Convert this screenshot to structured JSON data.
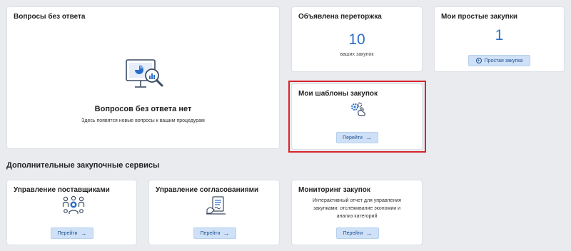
{
  "questions": {
    "title": "Вопросы без ответа",
    "empty_title": "Вопросов без ответа нет",
    "empty_subtitle": "Здесь появятся новые вопросы к вашим процедурам",
    "icon": "analytics-monitor-icon"
  },
  "rebidding": {
    "title": "Объявлена переторжка",
    "count": "10",
    "caption": "ваших закупок"
  },
  "simple_purchases": {
    "title": "Мои простые закупки",
    "count": "1",
    "button_label": "Простая закупка"
  },
  "templates": {
    "title": "Мои шаблоны закупок",
    "icon": "gear-hand-icon",
    "button_label": "Перейти"
  },
  "services": {
    "section_title": "Дополнительные закупочные сервисы",
    "suppliers": {
      "title": "Управление поставщиками",
      "icon": "people-group-icon",
      "button_label": "Перейти"
    },
    "approvals": {
      "title": "Управление согласованиями",
      "icon": "document-sign-icon",
      "button_label": "Перейти"
    },
    "monitoring": {
      "title": "Мониторинг закупок",
      "description_lines": [
        "Интерактивный отчет для управления",
        "закупками: отслеживание экономии и",
        "анализ категорий"
      ],
      "button_label": "Перейти"
    }
  },
  "colors": {
    "accent": "#2b6ec9",
    "button_bg": "#cfe1f7",
    "highlight": "#d9232a",
    "page_bg": "#e9ebef"
  }
}
